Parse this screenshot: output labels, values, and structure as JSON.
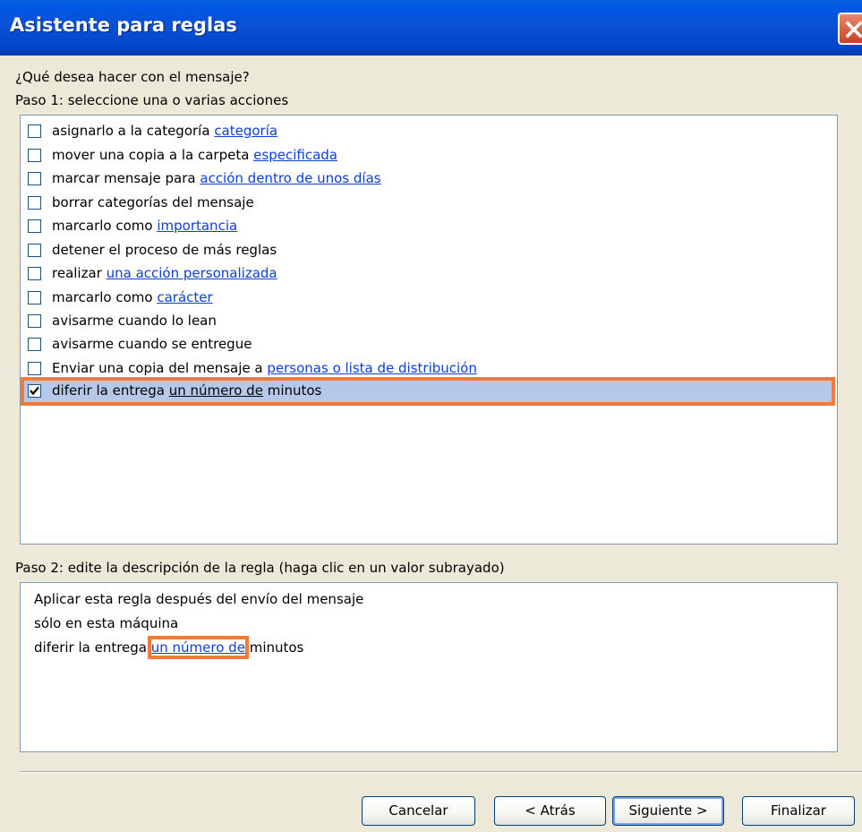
{
  "window": {
    "title": "Asistente para reglas"
  },
  "prompt": "¿Qué desea hacer con el mensaje?",
  "step1_label": "Paso 1: seleccione una o varias acciones",
  "actions": [
    {
      "prefix": "asignarlo a la categoría ",
      "link": "categoría",
      "suffix": "",
      "checked": false
    },
    {
      "prefix": "mover una copia a la carpeta ",
      "link": "especificada",
      "suffix": "",
      "checked": false
    },
    {
      "prefix": "marcar mensaje para ",
      "link": "acción dentro de unos días",
      "suffix": "",
      "checked": false
    },
    {
      "prefix": "borrar categorías del mensaje",
      "link": "",
      "suffix": "",
      "checked": false
    },
    {
      "prefix": "marcarlo como ",
      "link": "importancia",
      "suffix": "",
      "checked": false
    },
    {
      "prefix": "detener el proceso de más reglas",
      "link": "",
      "suffix": "",
      "checked": false
    },
    {
      "prefix": "realizar ",
      "link": "una acción personalizada",
      "suffix": "",
      "checked": false
    },
    {
      "prefix": "marcarlo como ",
      "link": "carácter",
      "suffix": "",
      "checked": false
    },
    {
      "prefix": "avisarme cuando lo lean",
      "link": "",
      "suffix": "",
      "checked": false
    },
    {
      "prefix": "avisarme cuando se entregue",
      "link": "",
      "suffix": "",
      "checked": false
    },
    {
      "prefix": "Enviar una copia del mensaje a ",
      "link": "personas o lista de distribución",
      "suffix": "",
      "checked": false
    },
    {
      "prefix": "diferir la entrega ",
      "link": "un número de",
      "suffix": " minutos",
      "checked": true
    }
  ],
  "step2_label": "Paso 2: edite la descripción de la regla (haga clic en un valor subrayado)",
  "description": {
    "line1": "Aplicar esta regla después del envío del mensaje",
    "line2": "sólo en esta máquina",
    "line3_prefix": "diferir la entrega ",
    "line3_link": "un número de",
    "line3_suffix": " minutos"
  },
  "buttons": {
    "cancel": "Cancelar",
    "back": "< Atrás",
    "next": "Siguiente >",
    "finish": "Finalizar"
  },
  "colors": {
    "titlebar": "#0054e3",
    "highlight_outline": "#f47a38",
    "selection": "#b6c8ea",
    "link": "#0b3fd6"
  }
}
